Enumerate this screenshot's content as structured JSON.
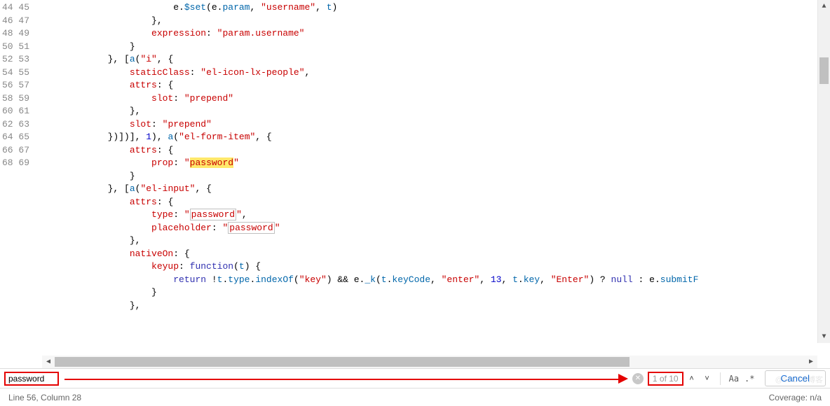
{
  "gutter": {
    "start": 44,
    "end": 69
  },
  "code": {
    "l44": {
      "indent": "                        ",
      "p1": "e.",
      "m": "$set",
      "p2": "(e.",
      "v1": "param",
      "p3": ", ",
      "s1": "\"username\"",
      "p4": ", ",
      "v2": "t",
      "p5": ")"
    },
    "l45": {
      "indent": "                    ",
      "t": "},"
    },
    "l46": {
      "indent": "                    ",
      "k": "expression",
      "c": ": ",
      "s": "\"param.username\""
    },
    "l47": {
      "indent": "                ",
      "t": "}"
    },
    "l48": {
      "indent": "            ",
      "p1": "}, [",
      "m": "a",
      "p2": "(",
      "s": "\"i\"",
      "p3": ", {"
    },
    "l49": {
      "indent": "                ",
      "k": "staticClass",
      "c": ": ",
      "s": "\"el-icon-lx-people\"",
      "p": ","
    },
    "l50": {
      "indent": "                ",
      "k": "attrs",
      "c": ": {"
    },
    "l51": {
      "indent": "                    ",
      "k": "slot",
      "c": ": ",
      "s": "\"prepend\""
    },
    "l52": {
      "indent": "                ",
      "t": "},"
    },
    "l53": {
      "indent": "                ",
      "k": "slot",
      "c": ": ",
      "s": "\"prepend\""
    },
    "l54": {
      "indent": "            ",
      "p1": "})])], ",
      "n": "1",
      "p2": "), ",
      "m": "a",
      "p3": "(",
      "s": "\"el-form-item\"",
      "p4": ", {"
    },
    "l55": {
      "indent": "                ",
      "k": "attrs",
      "c": ": {"
    },
    "l56": {
      "indent": "                    ",
      "k": "prop",
      "c": ": ",
      "q1": "\"",
      "hl": "password",
      "q2": "\""
    },
    "l57": {
      "indent": "                ",
      "t": "}"
    },
    "l58": {
      "indent": "            ",
      "p1": "}, [",
      "m": "a",
      "p2": "(",
      "s": "\"el-input\"",
      "p3": ", {"
    },
    "l59": {
      "indent": "                ",
      "k": "attrs",
      "c": ": {"
    },
    "l60": {
      "indent": "                    ",
      "k": "type",
      "c": ": ",
      "q1": "\"",
      "box": "password",
      "q2": "\"",
      "p": ","
    },
    "l61": {
      "indent": "                    ",
      "k": "placeholder",
      "c": ": ",
      "q1": "\"",
      "box": "password",
      "q2": "\""
    },
    "l62": {
      "indent": "                ",
      "t": "},"
    },
    "l63": {
      "indent": "                ",
      "k": "nativeOn",
      "c": ": {"
    },
    "l64": {
      "indent": "                    ",
      "k": "keyup",
      "c": ": ",
      "kw": "function",
      "p1": "(",
      "v": "t",
      "p2": ") {"
    },
    "l65": {
      "indent": "                        ",
      "kw": "return",
      "sp": " ",
      "p1": "!",
      "v1": "t",
      "p2": ".",
      "v2": "type",
      "p3": ".",
      "m": "indexOf",
      "p4": "(",
      "s1": "\"key\"",
      "p5": ") && e.",
      "m2": "_k",
      "p6": "(",
      "v3": "t",
      "p7": ".",
      "v4": "keyCode",
      "p8": ", ",
      "s2": "\"enter\"",
      "p9": ", ",
      "n": "13",
      "p10": ", ",
      "v5": "t",
      "p11": ".",
      "v6": "key",
      "p12": ", ",
      "s3": "\"Enter\"",
      "p13": ") ? ",
      "kw2": "null",
      "p14": " : e.",
      "v7": "submitF"
    },
    "l66": {
      "indent": "                    ",
      "t": "}"
    },
    "l67": {
      "indent": "                ",
      "t": "},"
    },
    "l68": {
      "indent": "",
      "t": ""
    },
    "l69": {
      "indent": "",
      "t": ""
    }
  },
  "find": {
    "value": "password",
    "count": "1 of 10",
    "cancel": "Cancel",
    "aa": "Aa",
    "regex": ".*"
  },
  "status": {
    "pos": "Line 56, Column 28",
    "coverage": "Coverage: n/a"
  },
  "watermark": "@51CTO博客"
}
